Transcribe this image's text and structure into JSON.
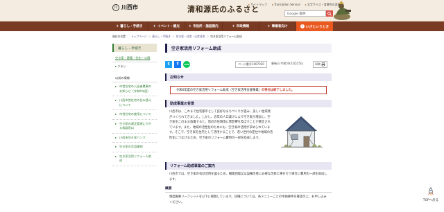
{
  "header": {
    "logo_mark": "川",
    "logo_text": "川西市",
    "site_title": "清和源氏のふるさと",
    "util_links": [
      "サイトマップ",
      "Translation Service",
      "文字サイズ・背景色の変更"
    ],
    "search_placeholder": "Google 提供"
  },
  "nav": {
    "items": [
      "暮らし・手続き",
      "イベント・観光",
      "市役所・施設案内",
      "市政情報",
      "事業者向け"
    ],
    "emergency": "いざというとき"
  },
  "breadcrumb": [
    "現在の位置",
    "トップページ",
    "暮らし・手続き",
    "空き家・住宅・公営住宅",
    "空き家活用リフォーム助成"
  ],
  "sidebar": {
    "head": "暮らし・手続き",
    "sub": "空き家・建築・住宅・公園",
    "sub2": "すまい",
    "section": "以前の情報",
    "items": [
      "市営住宅の入居者募集のお知らせ（令和6年度）",
      "川西市営住宅の住み替えについて",
      "市営住宅の使用について",
      "空き家の適正管理にかかる相談窓口",
      "川西市空き家バンク",
      "空き家の活用事例",
      "空き家活用リフォーム助成"
    ]
  },
  "main": {
    "title": "空き家活用リフォーム助成",
    "page_id": "ページ番号1007030",
    "updated": "更新日 令和5年12月25日",
    "print": "印刷",
    "share": [
      "t",
      "f",
      "LINE"
    ],
    "notice_head": "お知らせ",
    "notice_text": "令和6年度の空き家活用リフォーム助成（空き家活用支援事業）",
    "notice_red": "の受付は終了しました。",
    "background_head": "助成事業の背景",
    "background_text": "川西市は、これまで住宅都市として良好なまちづくりが進み、美しい住環境がつくられてきました。しかし、近年の人口減少により空き家が増加し、空き家をこのまま放置すると、周辺の住環境に悪影響を及ぼすことが懸念されています。また、地域の活性化のためにも、空き家の活用が求められています。そこで、空き家を住宅として活用することで、若い世代の定住や地域の活性化につなげるため、空き家のリフォーム費用の一部を助成します。",
    "summary_head": "リフォーム助成事業のご案内",
    "summary_text": "川西市では、空き家の有効活用を図るため、機能回復又は設備改善に必要な改修工事を行う場合に費用の一部を助成します。",
    "outline_head": "概要",
    "outline_text": "制度概要リーフレットを以下に掲載しています。詳細については、各メニューごとの申請要件を確認の上、お申し込みください。"
  },
  "page_top": "TOPへ戻る"
}
